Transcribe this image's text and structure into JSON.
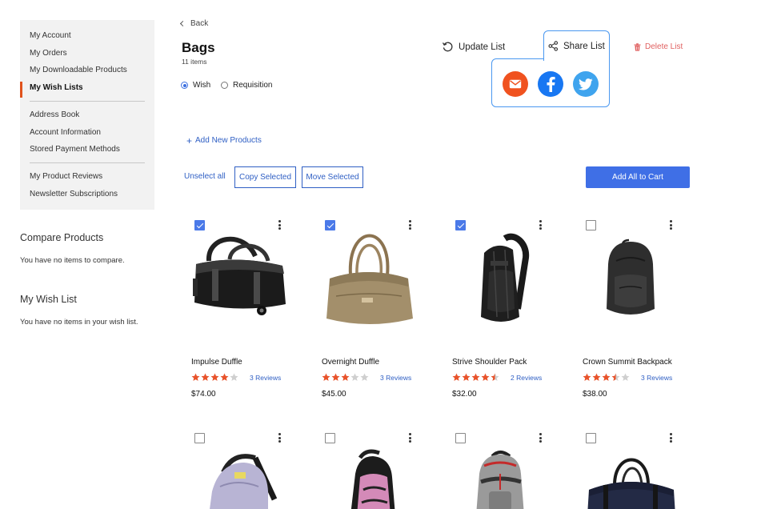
{
  "sidebar": {
    "items": [
      {
        "label": "My Account"
      },
      {
        "label": "My Orders"
      },
      {
        "label": "My Downloadable Products"
      },
      {
        "label": "My Wish Lists",
        "active": true
      },
      {
        "label": "Address Book"
      },
      {
        "label": "Account Information"
      },
      {
        "label": "Stored Payment Methods"
      },
      {
        "label": "My Product Reviews"
      },
      {
        "label": "Newsletter Subscriptions"
      }
    ]
  },
  "compare": {
    "title": "Compare Products",
    "text": "You have no items to compare."
  },
  "wishlist_block": {
    "title": "My Wish List",
    "text": "You have no items in your wish list."
  },
  "header": {
    "back_label": "Back",
    "title": "Bags",
    "count": "11 items",
    "type_options": [
      {
        "label": "Wish",
        "selected": true
      },
      {
        "label": "Requisition",
        "selected": false
      }
    ],
    "update_label": "Update List",
    "share_label": "Share List",
    "delete_label": "Delete List"
  },
  "share_options": [
    {
      "name": "email",
      "icon": "mail-icon",
      "color": "#f0521f"
    },
    {
      "name": "facebook",
      "icon": "facebook-icon",
      "color": "#1877f2"
    },
    {
      "name": "twitter",
      "icon": "twitter-icon",
      "color": "#3fa4ee"
    }
  ],
  "toolbar": {
    "add_new_label": "Add New Products",
    "unselect_label": "Unselect all",
    "copy_label": "Copy Selected",
    "move_label": "Move Selected",
    "add_all_label": "Add All to Cart"
  },
  "colors": {
    "accent": "#3f6fe6",
    "link": "#2f5fc4",
    "star": "#e8532b",
    "active_marker": "#e0521c",
    "delete": "#e06060"
  },
  "products": [
    {
      "name": "Impulse Duffle",
      "rating": 4,
      "reviews": "3 Reviews",
      "price": "$74.00",
      "checked": true
    },
    {
      "name": "Overnight Duffle",
      "rating": 3,
      "reviews": "3 Reviews",
      "price": "$45.00",
      "checked": true
    },
    {
      "name": "Strive Shoulder Pack",
      "rating": 4.5,
      "reviews": "2 Reviews",
      "price": "$32.00",
      "checked": true
    },
    {
      "name": "Crown Summit Backpack",
      "rating": 3.5,
      "reviews": "3 Reviews",
      "price": "$38.00",
      "checked": false
    },
    {
      "checked": false
    },
    {
      "checked": false
    },
    {
      "checked": false
    },
    {
      "checked": false
    }
  ]
}
